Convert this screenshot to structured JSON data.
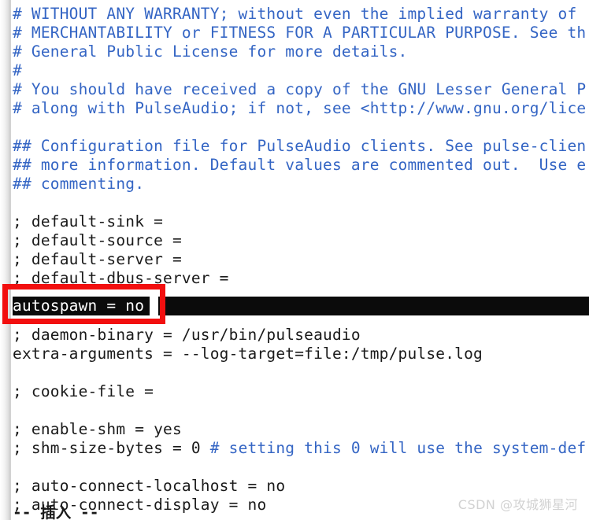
{
  "editor": {
    "mode_status": "-- 插入 --",
    "colors": {
      "background": "#ffffff",
      "comment_text": "#3465c4",
      "code_text": "#1a1a1a",
      "highlight_background": "#0b0b0b",
      "highlight_text": "#ffffff",
      "annotation_red": "#f20f0f",
      "watermark_gray": "#d2d2d2"
    },
    "lines": [
      {
        "text": "# WITHOUT ANY WARRANTY; without even the implied warranty of",
        "kind": "comment"
      },
      {
        "text": "# MERCHANTABILITY or FITNESS FOR A PARTICULAR PURPOSE. See th",
        "kind": "comment"
      },
      {
        "text": "# General Public License for more details.",
        "kind": "comment"
      },
      {
        "text": "#",
        "kind": "comment"
      },
      {
        "text": "# You should have received a copy of the GNU Lesser General P",
        "kind": "comment"
      },
      {
        "text": "# along with PulseAudio; if not, see <http://www.gnu.org/lice",
        "kind": "comment"
      },
      {
        "text": "",
        "kind": "blank"
      },
      {
        "text": "## Configuration file for PulseAudio clients. See pulse-clien",
        "kind": "comment"
      },
      {
        "text": "## more information. Default values are commented out.  Use e",
        "kind": "comment"
      },
      {
        "text": "## commenting.",
        "kind": "comment"
      },
      {
        "text": "",
        "kind": "blank"
      },
      {
        "text": "; default-sink =",
        "kind": "code"
      },
      {
        "text": "; default-source =",
        "kind": "code"
      },
      {
        "text": "; default-server =",
        "kind": "code"
      },
      {
        "text": "; default-dbus-server =",
        "kind": "code"
      },
      {
        "text": "",
        "kind": "blank"
      },
      {
        "text": "autospawn = no",
        "kind": "highlighted"
      },
      {
        "text": "; daemon-binary = /usr/bin/pulseaudio",
        "kind": "code"
      },
      {
        "text": "extra-arguments = --log-target=file:/tmp/pulse.log",
        "kind": "code"
      },
      {
        "text": "",
        "kind": "blank"
      },
      {
        "text": "; cookie-file =",
        "kind": "code"
      },
      {
        "text": "",
        "kind": "blank"
      },
      {
        "text": "; enable-shm = yes",
        "kind": "code"
      },
      {
        "text": "; shm-size-bytes = 0 ",
        "kind": "code",
        "inline_comment": "# setting this 0 will use the system-def"
      },
      {
        "text": "",
        "kind": "blank"
      },
      {
        "text": "; auto-connect-localhost = no",
        "kind": "code"
      },
      {
        "text": "; auto-connect-display = no",
        "kind": "code"
      }
    ],
    "highlighted_line": {
      "text": "autospawn = no",
      "line_index": 16
    },
    "annotation": {
      "shape": "rectangle",
      "color": "#f20f0f",
      "target_text": "autospawn = no"
    }
  },
  "watermark": {
    "text": "CSDN @攻城狮星河"
  }
}
